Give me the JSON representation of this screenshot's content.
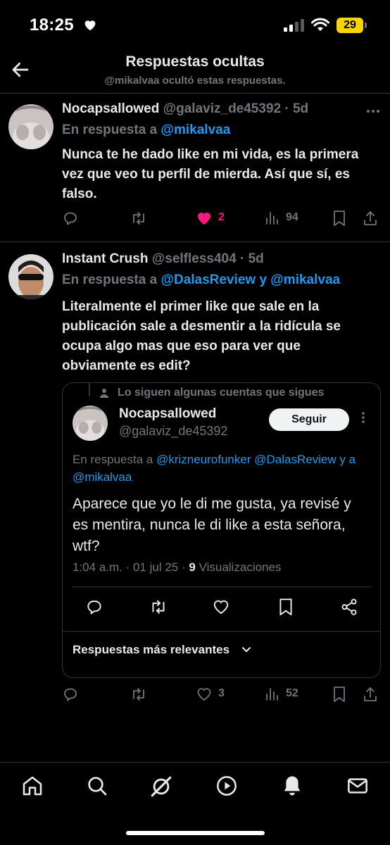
{
  "status_bar": {
    "time": "18:25",
    "battery": "29"
  },
  "header": {
    "title": "Respuestas ocultas",
    "subtitle": "@mikalvaa ocultó estas respuestas."
  },
  "tweets": [
    {
      "name": "Nocapsallowed",
      "handle": "@galaviz_de45392",
      "time": "· 5d",
      "reply_prefix": "En respuesta a ",
      "reply_to": "@mikalvaa",
      "text": "Nunca te he dado like en mi vida, es la primera vez que veo tu perfil de mierda. Así que sí, es falso.",
      "likes": "2",
      "views": "94"
    },
    {
      "name": "Instant Crush",
      "handle": "@selfless404",
      "time": "· 5d",
      "reply_prefix": "En respuesta a ",
      "reply_to": "@DalasReview y @mikalvaa",
      "text": "Literalmente el primer like que sale en la publicación sale a desmentir a la ridícula se ocupa algo mas que eso para ver que obviamente es edit?",
      "likes": "3",
      "views": "52"
    }
  ],
  "quote": {
    "social_context": "Lo siguen algunas cuentas que sigues",
    "name": "Nocapsallowed",
    "handle": "@galaviz_de45392",
    "follow_label": "Seguir",
    "reply_prefix": "En respuesta a ",
    "reply_to": "@krizneurofunker @DalasReview y a @mikalvaa",
    "text": "Aparece que yo le di me gusta, ya revisé y es mentira, nunca le di like a esta señora, wtf?",
    "meta_time": "1:04 a.m. · 01 jul 25 · ",
    "meta_views": "9",
    "meta_views_label": " Visualizaciones",
    "sort_label": "Respuestas más relevantes"
  },
  "colors": {
    "accent": "#1d9bf0",
    "like": "#f91880",
    "muted": "#71767b",
    "text": "#e7e9ea"
  },
  "icons": [
    "back-arrow-icon",
    "more-icon",
    "reply-icon",
    "repost-icon",
    "heart-icon",
    "views-icon",
    "bookmark-icon",
    "share-icon",
    "home-icon",
    "search-icon",
    "grok-icon",
    "video-icon",
    "notifications-icon",
    "messages-icon"
  ]
}
